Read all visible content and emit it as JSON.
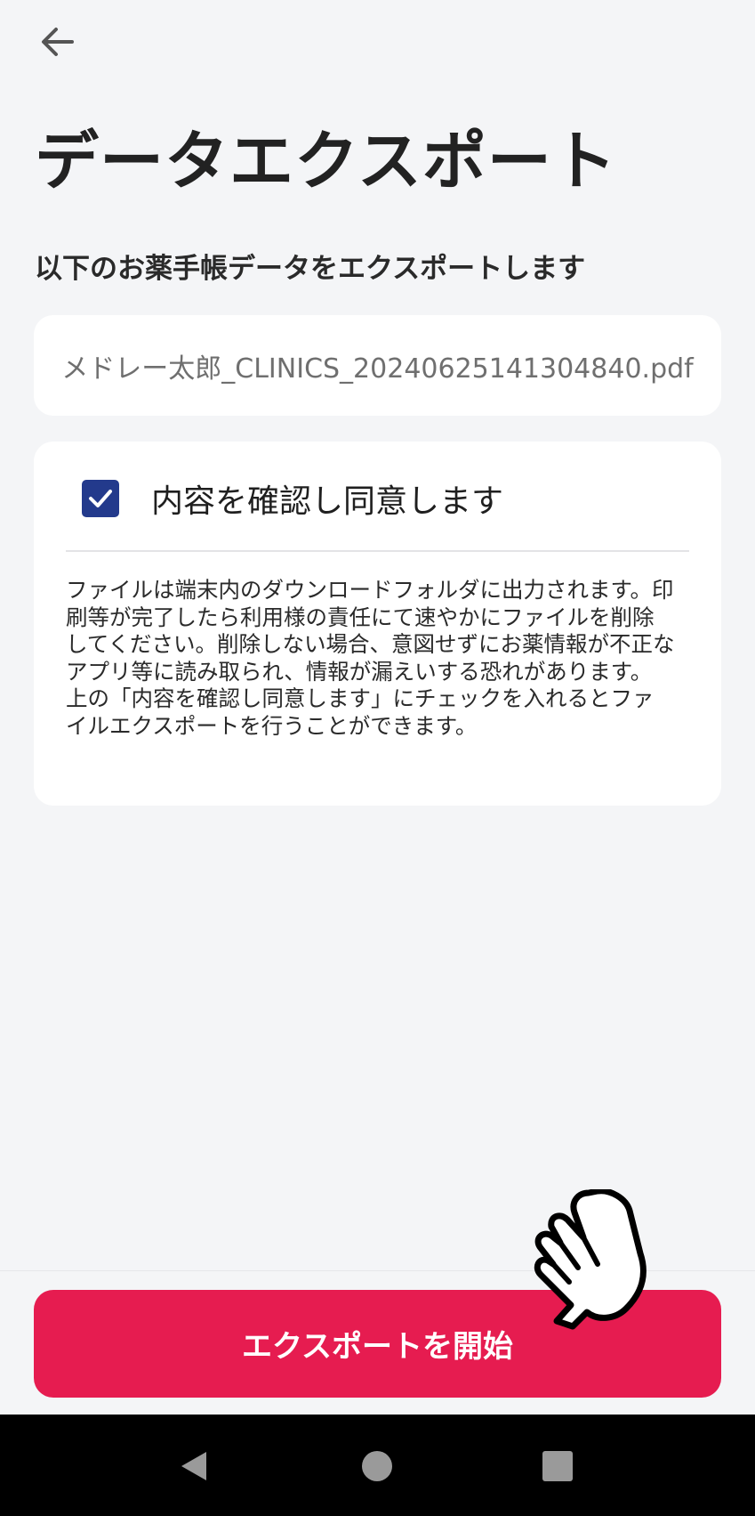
{
  "header": {
    "back_icon": "arrow-left-icon",
    "title": "データエクスポート"
  },
  "main": {
    "subtitle": "以下のお薬手帳データをエクスポートします",
    "file_name": "メドレー太郎_CLINICS_20240625141304840.pdf",
    "agreement": {
      "checked": true,
      "label": "内容を確認し同意します",
      "checkbox_color": "#233a8c",
      "notice_paragraph_1": "ファイルは端末内のダウンロードフォルダに出力されます。印刷等が完了したら利用様の責任にて速やかにファイルを削除してください。削除しない場合、意図せずにお薬情報が不正なアプリ等に読み取られ、情報が漏えいする恐れがあります。",
      "notice_paragraph_2": "上の「内容を確認し同意します」にチェックを入れるとファイルエクスポートを行うことができます。"
    }
  },
  "footer": {
    "export_button_label": "エクスポートを開始",
    "export_button_color": "#e61c50"
  },
  "overlay": {
    "cursor_icon": "pointing-hand-cursor-icon"
  },
  "system_nav": {
    "back_icon": "triangle-back-icon",
    "home_icon": "circle-home-icon",
    "recents_icon": "square-recents-icon"
  }
}
